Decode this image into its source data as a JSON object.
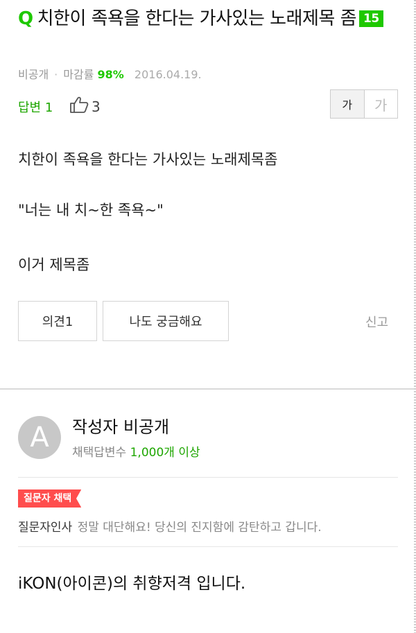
{
  "question": {
    "icon": "Q",
    "title": "치한이 족욕을 한다는 가사있는 노래제목 좀",
    "view_badge": "15",
    "visibility": "비공개",
    "close_rate_label": "마감률",
    "close_rate": "98%",
    "date": "2016.04.19.",
    "answers_label": "답변 1",
    "likes": "3",
    "font_btn_small": "가",
    "font_btn_large": "가",
    "body": [
      "치한이 족욕을 한다는 가사있는 노래제목좀",
      "\"너는 내 치~한 족욕~\"",
      "이거 제목좀"
    ],
    "opinion_button": "의견1",
    "curious_button": "나도 궁금해요",
    "report": "신고"
  },
  "answer": {
    "avatar_letter": "A",
    "author": "작성자 비공개",
    "adopt_label": "채택답변수",
    "adopt_count": "1,000개 이상",
    "chosen_tag": "질문자 채택",
    "thanks_label": "질문자인사",
    "thanks_message": "정말 대단해요! 당신의 진지함에 감탄하고 갑니다.",
    "text": "iKON(아이콘)의 취향저격 입니다."
  }
}
